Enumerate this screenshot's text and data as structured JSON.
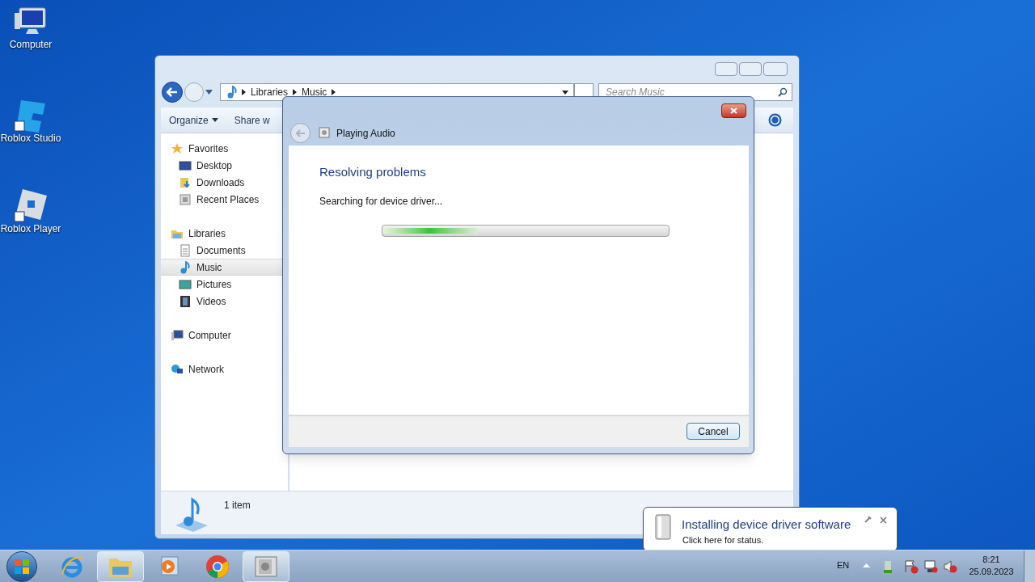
{
  "desktop_icons": [
    {
      "label": "Computer",
      "kind": "computer"
    },
    {
      "label": "Roblox Studio",
      "kind": "studio"
    },
    {
      "label": "Roblox Player",
      "kind": "player"
    }
  ],
  "explorer": {
    "breadcrumb": [
      "Libraries",
      "Music"
    ],
    "search": {
      "placeholder": "Search Music"
    },
    "toolbar": [
      "Organize",
      "Share w"
    ],
    "nav": [
      {
        "label": "Favorites",
        "kind": "star",
        "children": [
          {
            "label": "Desktop",
            "kind": "desktop",
            "selected": false
          },
          {
            "label": "Downloads",
            "kind": "downloads",
            "selected": false
          },
          {
            "label": "Recent Places",
            "kind": "recent",
            "selected": false
          }
        ]
      },
      {
        "label": "Libraries",
        "kind": "library",
        "children": [
          {
            "label": "Documents",
            "kind": "documents",
            "selected": false
          },
          {
            "label": "Music",
            "kind": "music",
            "selected": true
          },
          {
            "label": "Pictures",
            "kind": "pictures",
            "selected": false
          },
          {
            "label": "Videos",
            "kind": "videos",
            "selected": false
          }
        ]
      },
      {
        "label": "Computer",
        "kind": "computer"
      },
      {
        "label": "Network",
        "kind": "network"
      }
    ],
    "status": "1 item"
  },
  "dialog": {
    "title": "Playing Audio",
    "heading": "Resolving problems",
    "message": "Searching for device driver...",
    "progress": {
      "level": 0.33
    },
    "button": "Cancel"
  },
  "notification": {
    "title": "Installing device driver software",
    "text": "Click here for status."
  },
  "taskbar": {
    "apps": [
      {
        "kind": "ie",
        "active": false
      },
      {
        "kind": "explorer",
        "active": true
      },
      {
        "kind": "media",
        "active": false
      },
      {
        "kind": "chrome",
        "active": false
      },
      {
        "kind": "audio",
        "active": true
      }
    ],
    "language": "EN",
    "time": "8:21",
    "date": "25.09.2023"
  }
}
